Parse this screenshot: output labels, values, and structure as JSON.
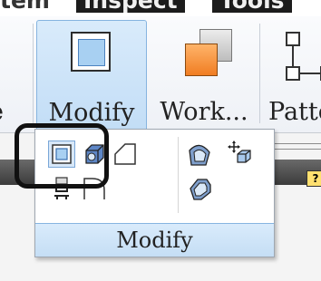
{
  "menubar": {
    "partial_label": "tem",
    "inspect_label": "Inspect",
    "tools_label": "Tools"
  },
  "ribbon": {
    "partial_left_label": "e",
    "modify_label": "Modify",
    "work_label": "Work...",
    "pattern_label": "Patte"
  },
  "panel": {
    "footer_label": "Modify",
    "tools": [
      "thicken-tool-icon",
      "shell-tool-icon",
      "chamfer-tool-icon",
      "draft-tool-icon",
      "move-face-tool-icon",
      "emboss-tool-icon",
      "fillet-tool-icon",
      "round-tool-icon"
    ]
  },
  "help": {
    "label": "?"
  },
  "colors": {
    "ribbon_active": "#c2ddf6",
    "accent_orange": "#f07d22",
    "highlight": "#111111"
  }
}
